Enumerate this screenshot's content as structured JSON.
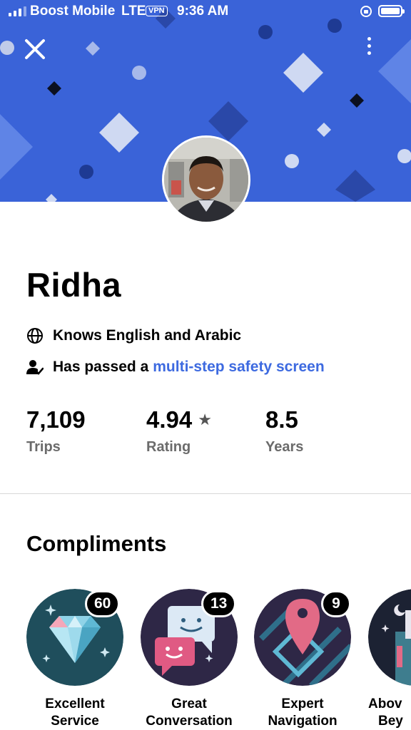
{
  "status_bar": {
    "carrier": "Boost Mobile",
    "network": "LTE",
    "vpn": "VPN",
    "time": "9:36 AM"
  },
  "header": {
    "banner_color": "#3a63d8"
  },
  "profile": {
    "name": "Ridha",
    "languages": "Knows English and Arabic",
    "safety_prefix": "Has passed a",
    "safety_link": "multi-step safety screen",
    "link_color": "#3d6ae0"
  },
  "stats": [
    {
      "value": "7,109",
      "label": "Trips"
    },
    {
      "value": "4.94",
      "label": "Rating",
      "icon": "star-icon"
    },
    {
      "value": "8.5",
      "label": "Years"
    }
  ],
  "compliments": {
    "title": "Compliments",
    "items": [
      {
        "count": "60",
        "label_line1": "Excellent",
        "label_line2": "Service",
        "icon": "diamond-badge-icon"
      },
      {
        "count": "13",
        "label_line1": "Great",
        "label_line2": "Conversation",
        "icon": "chat-bubbles-badge-icon"
      },
      {
        "count": "9",
        "label_line1": "Expert",
        "label_line2": "Navigation",
        "icon": "map-pin-badge-icon"
      },
      {
        "count": "",
        "label_line1": "Abov",
        "label_line2": "Bey",
        "icon": "night-castle-badge-icon"
      }
    ]
  }
}
